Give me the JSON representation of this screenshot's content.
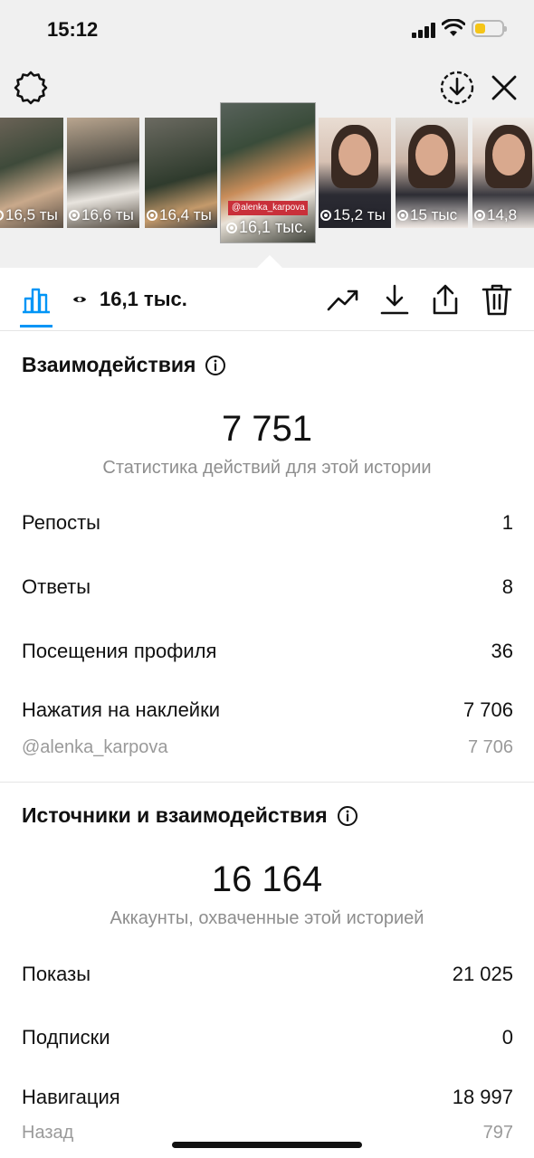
{
  "status_bar": {
    "time": "15:12",
    "battery_level": 0.4
  },
  "toolbar": {
    "settings_icon": "gear-icon",
    "save_icon": "download-circle-icon",
    "close_icon": "close-icon"
  },
  "thumbnails": [
    {
      "label": "16,5 ты"
    },
    {
      "label": "16,6 ты"
    },
    {
      "label": "16,4 ты"
    },
    {
      "label": "16,1 тыс.",
      "tag": "@alenka_karpova",
      "selected": true
    },
    {
      "label": "15,2 ты"
    },
    {
      "label": "15 тыс"
    },
    {
      "label": "14,8"
    }
  ],
  "action_bar": {
    "views": "16,1 тыс.",
    "icons": [
      "bar-chart-icon",
      "eye-icon",
      "trend-up-icon",
      "download-icon",
      "share-icon",
      "trash-icon"
    ]
  },
  "interactions": {
    "title": "Взаимодействия",
    "total": "7 751",
    "caption": "Статистика действий для этой истории",
    "rows": [
      {
        "label": "Репосты",
        "value": "1"
      },
      {
        "label": "Ответы",
        "value": "8"
      },
      {
        "label": "Посещения профиля",
        "value": "36"
      },
      {
        "label": "Нажатия на наклейки",
        "value": "7 706"
      }
    ],
    "sub_row": {
      "label": "@alenka_karpova",
      "value": "7 706"
    }
  },
  "discovery": {
    "title": "Источники и взаимодействия",
    "total": "16 164",
    "caption": "Аккаунты, охваченные этой историей",
    "rows": [
      {
        "label": "Показы",
        "value": "21 025"
      },
      {
        "label": "Подписки",
        "value": "0"
      },
      {
        "label": "Навигация",
        "value": "18 997"
      }
    ],
    "sub_row": {
      "label": "Назад",
      "value": "797"
    }
  },
  "colors": {
    "accent": "#0095f6",
    "top_background": "#f0f0f0",
    "battery": "#f5c518",
    "muted_text": "#8e8e8e"
  }
}
